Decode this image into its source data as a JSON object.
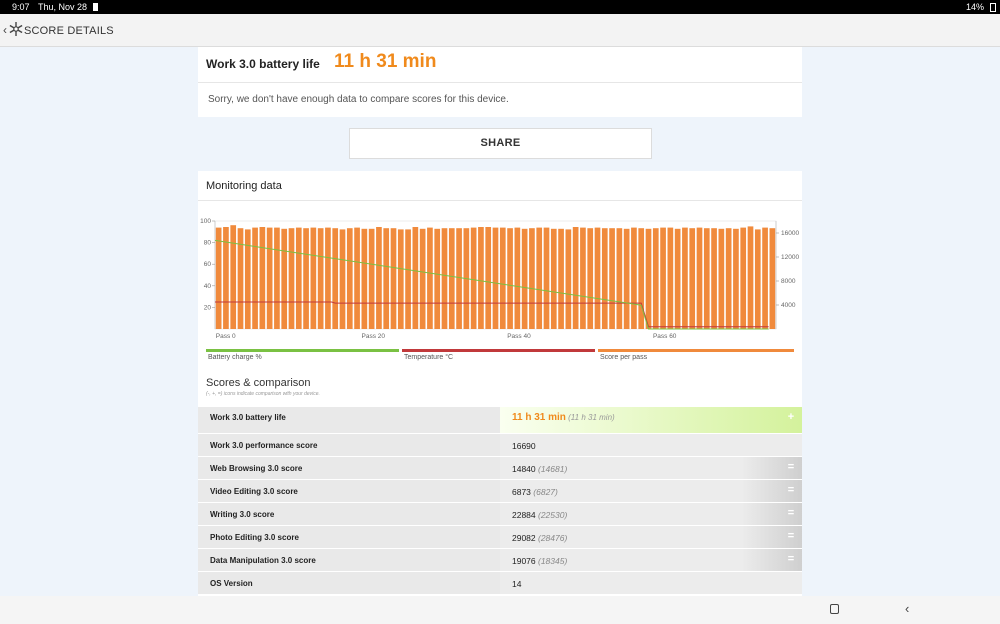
{
  "status_bar": {
    "time": "9:07",
    "date": "Thu, Nov 28",
    "battery": "14%"
  },
  "app_bar": {
    "title": "SCORE DETAILS",
    "back_icon": "chevron-left-icon",
    "logo_icon": "snowflake-icon"
  },
  "battery": {
    "label": "Work 3.0 battery life",
    "value": "11 h 31 min",
    "message": "Sorry, we don't have enough data to compare scores for this device."
  },
  "share_label": "SHARE",
  "monitoring": {
    "title": "Monitoring data",
    "legend": [
      {
        "label": "Battery charge %",
        "color": "#7ac143"
      },
      {
        "label": "Temperature °C",
        "color": "#c1393b"
      },
      {
        "label": "Score per pass",
        "color": "#f08a3c"
      }
    ]
  },
  "chart_data": {
    "type": "bar",
    "x_ticks": [
      "Pass 0",
      "Pass 20",
      "Pass 40",
      "Pass 60"
    ],
    "left_axis": {
      "ticks": [
        "100",
        "80",
        "60",
        "40",
        "20"
      ],
      "ylim": [
        0,
        100
      ]
    },
    "right_axis": {
      "ticks": [
        "16000",
        "12000",
        "8000",
        "4000"
      ],
      "ylim": [
        0,
        18000
      ]
    },
    "series": [
      {
        "name": "Score per pass",
        "color": "#f08a3c",
        "values": [
          16900,
          17000,
          17300,
          16800,
          16600,
          16900,
          17000,
          16900,
          16900,
          16700,
          16800,
          16900,
          16800,
          16900,
          16800,
          16900,
          16800,
          16600,
          16800,
          16900,
          16700,
          16700,
          17000,
          16800,
          16800,
          16600,
          16600,
          17000,
          16700,
          16900,
          16700,
          16800,
          16800,
          16800,
          16800,
          16900,
          17000,
          17000,
          16900,
          16900,
          16800,
          16900,
          16700,
          16800,
          16900,
          16900,
          16700,
          16700,
          16600,
          17000,
          16900,
          16800,
          16900,
          16800,
          16800,
          16800,
          16700,
          16900,
          16800,
          16700,
          16800,
          16900,
          16900,
          16700,
          16900,
          16800,
          16900,
          16800,
          16800,
          16700,
          16800,
          16700,
          16900,
          17100,
          16600,
          16900,
          16800
        ]
      },
      {
        "name": "Battery charge %",
        "color": "#7ac143",
        "x": [
          0,
          58.5,
          59.5,
          76
        ],
        "values": [
          82,
          22,
          0,
          0
        ]
      },
      {
        "name": "Temperature °C",
        "color": "#c1393b",
        "x": [
          0,
          16,
          16.5,
          58.5,
          59.5,
          76
        ],
        "values": [
          25,
          25,
          24,
          24,
          2,
          2
        ]
      }
    ]
  },
  "scores": {
    "title": "Scores & comparison",
    "subtitle": "(-, +, =) icons indicate comparison with your device.",
    "rows": [
      {
        "name": "Work 3.0 battery life",
        "value": "11 h 31 min",
        "compare": "(11 h 31 min)",
        "sign": "+"
      },
      {
        "name": "Work 3.0 performance score",
        "value": "16690",
        "compare": "",
        "sign": ""
      },
      {
        "name": "Web Browsing 3.0 score",
        "value": "14840",
        "compare": "(14681)",
        "sign": "="
      },
      {
        "name": "Video Editing 3.0 score",
        "value": "6873",
        "compare": "(6827)",
        "sign": "="
      },
      {
        "name": "Writing 3.0 score",
        "value": "22884",
        "compare": "(22530)",
        "sign": "="
      },
      {
        "name": "Photo Editing 3.0 score",
        "value": "29082",
        "compare": "(28476)",
        "sign": "="
      },
      {
        "name": "Data Manipulation 3.0 score",
        "value": "19076",
        "compare": "(18345)",
        "sign": "="
      },
      {
        "name": "OS Version",
        "value": "14",
        "compare": "",
        "sign": ""
      }
    ]
  },
  "nav": {
    "home_icon": "home-square-icon",
    "back_icon": "back-arrow-icon"
  }
}
